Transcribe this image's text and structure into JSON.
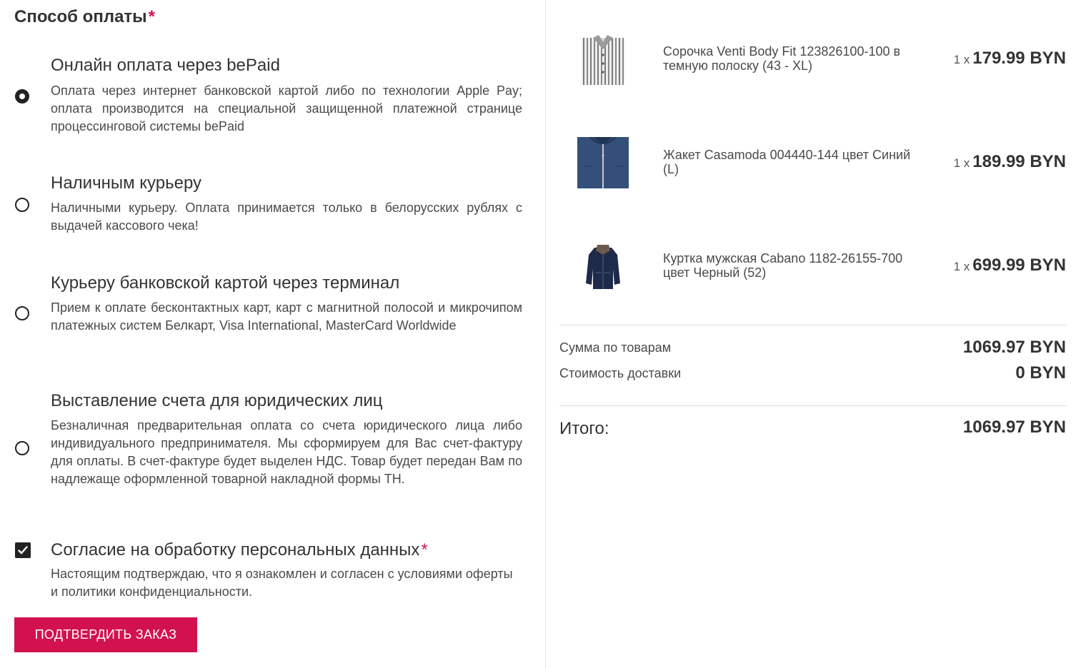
{
  "payment": {
    "title": "Способ оплаты",
    "required_mark": "*",
    "options": [
      {
        "title": "Онлайн оплата через bePaid",
        "description": "Оплата через интернет банковской картой либо по технологии Apple Pay; оплата производится на специальной защищенной платежной странице процессинговой системы bePaid",
        "selected": true
      },
      {
        "title": "Наличным курьеру",
        "description": "Наличными курьеру. Оплата принимается только в белорусских рублях с выдачей кассового чека!",
        "selected": false
      },
      {
        "title": "Курьеру банковской картой через терминал",
        "description": "Прием к оплате бесконтактных карт, карт с магнитной полосой и микрочипом платежных систем Белкарт, Visa International, MasterCard Worldwide",
        "selected": false
      },
      {
        "title": "Выставление счета для юридических лиц",
        "description": "Безналичная предварительная оплата со счета юридического лица либо индивидуального предпринимателя. Мы сформируем для Вас счет-фактуру для оплаты. В счет-фактуре будет выделен НДС. Товар будет передан Вам по надлежаще оформленной товарной накладной формы ТН.",
        "selected": false
      }
    ]
  },
  "consent": {
    "title": "Согласие на обработку персональных данных",
    "required_mark": "*",
    "description": "Настоящим подтверждаю, что я ознакомлен и согласен с условиями оферты и политики конфиденциальности.",
    "checked": true
  },
  "confirm_button": "ПОДТВЕРДИТЬ ЗАКАЗ",
  "cart": {
    "items": [
      {
        "name": "Сорочка Venti Body Fit 123826100-100 в темную полоску (43 - XL)",
        "qty": "1 x",
        "price": "179.99 BYN",
        "icon": "shirt-thumbnail"
      },
      {
        "name": "Жакет Casamoda 004440-144 цвет Синий (L)",
        "qty": "1 x",
        "price": "189.99 BYN",
        "icon": "jacket-thumbnail"
      },
      {
        "name": "Куртка мужская Cabano 1182-26155-700 цвет Черный (52)",
        "qty": "1 x",
        "price": "699.99 BYN",
        "icon": "coat-thumbnail"
      }
    ],
    "subtotal_label": "Сумма по товарам",
    "subtotal_value": "1069.97 BYN",
    "delivery_label": "Стоимость доставки",
    "delivery_value": "0 BYN",
    "total_label": "Итого:",
    "total_value": "1069.97 BYN"
  },
  "colors": {
    "accent": "#d2124f",
    "text": "#333333",
    "divider": "#dcdcdc"
  }
}
